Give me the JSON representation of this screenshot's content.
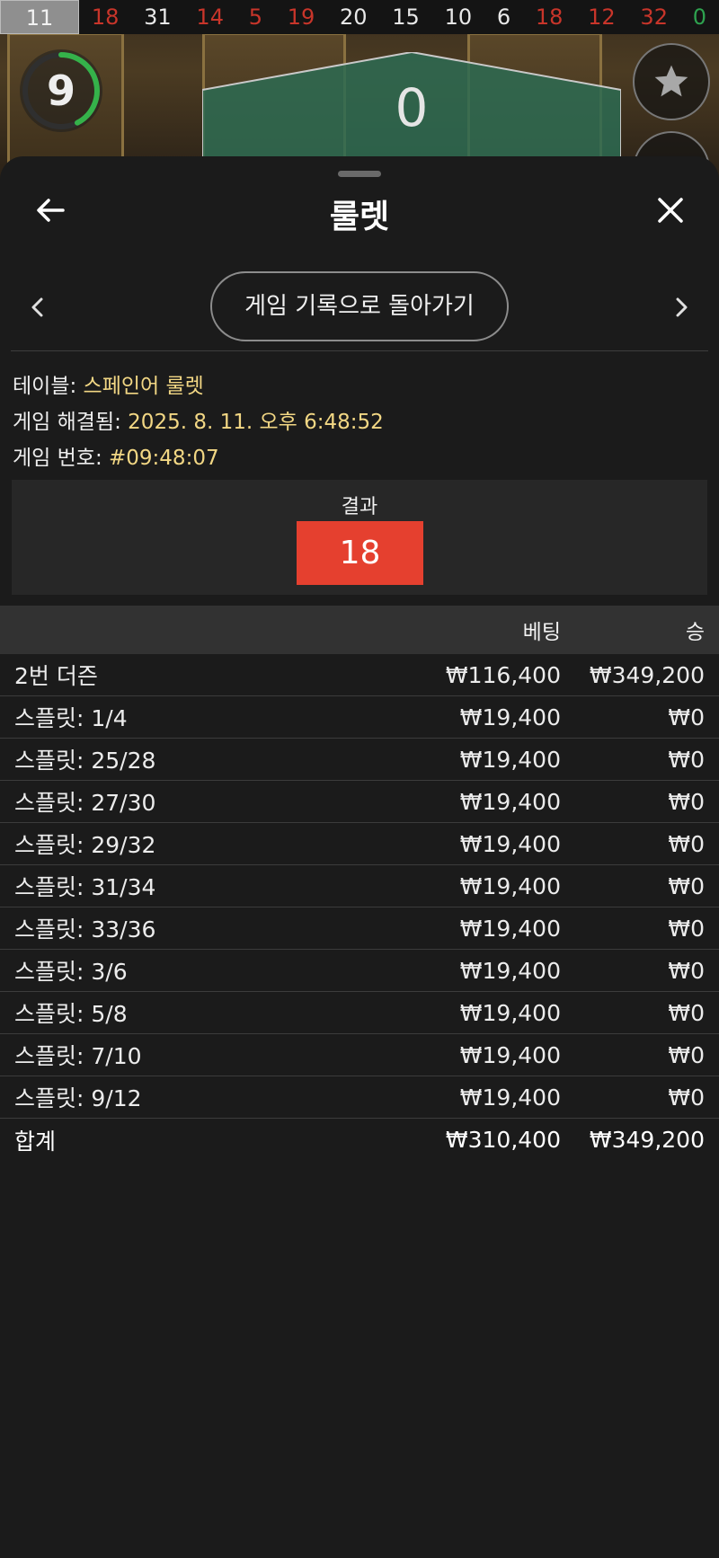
{
  "history": {
    "current": "11",
    "numbers": [
      {
        "value": "18",
        "color": "red"
      },
      {
        "value": "31",
        "color": "black"
      },
      {
        "value": "14",
        "color": "red"
      },
      {
        "value": "5",
        "color": "red"
      },
      {
        "value": "19",
        "color": "red"
      },
      {
        "value": "20",
        "color": "black"
      },
      {
        "value": "15",
        "color": "black"
      },
      {
        "value": "10",
        "color": "black"
      },
      {
        "value": "6",
        "color": "black"
      },
      {
        "value": "18",
        "color": "red"
      },
      {
        "value": "12",
        "color": "red"
      },
      {
        "value": "32",
        "color": "red"
      },
      {
        "value": "0",
        "color": "green"
      }
    ]
  },
  "game": {
    "timer": "9",
    "zero_label": "0",
    "fav_icon": "star-icon"
  },
  "sheet": {
    "title": "룰렛",
    "back_history_label": "게임 기록으로 돌아가기",
    "info": {
      "table_label": "테이블: ",
      "table_value": "스페인어 룰렛",
      "resolved_label": "게임 해결됨: ",
      "resolved_value": "2025. 8. 11. 오후 6:48:52",
      "number_label": "게임 번호: ",
      "number_value": "#09:48:07"
    },
    "result": {
      "label": "결과",
      "number": "18",
      "color": "#e5402f"
    }
  },
  "bets": {
    "header": {
      "name": "",
      "bet": "베팅",
      "win": "승"
    },
    "rows": [
      {
        "name": "2번 더즌",
        "bet": "₩116,400",
        "win": "₩349,200"
      },
      {
        "name": "스플릿: 1/4",
        "bet": "₩19,400",
        "win": "₩0"
      },
      {
        "name": "스플릿: 25/28",
        "bet": "₩19,400",
        "win": "₩0"
      },
      {
        "name": "스플릿: 27/30",
        "bet": "₩19,400",
        "win": "₩0"
      },
      {
        "name": "스플릿: 29/32",
        "bet": "₩19,400",
        "win": "₩0"
      },
      {
        "name": "스플릿: 31/34",
        "bet": "₩19,400",
        "win": "₩0"
      },
      {
        "name": "스플릿: 33/36",
        "bet": "₩19,400",
        "win": "₩0"
      },
      {
        "name": "스플릿: 3/6",
        "bet": "₩19,400",
        "win": "₩0"
      },
      {
        "name": "스플릿: 5/8",
        "bet": "₩19,400",
        "win": "₩0"
      },
      {
        "name": "스플릿: 7/10",
        "bet": "₩19,400",
        "win": "₩0"
      },
      {
        "name": "스플릿: 9/12",
        "bet": "₩19,400",
        "win": "₩0"
      }
    ],
    "total": {
      "name": "합계",
      "bet": "₩310,400",
      "win": "₩349,200"
    }
  }
}
